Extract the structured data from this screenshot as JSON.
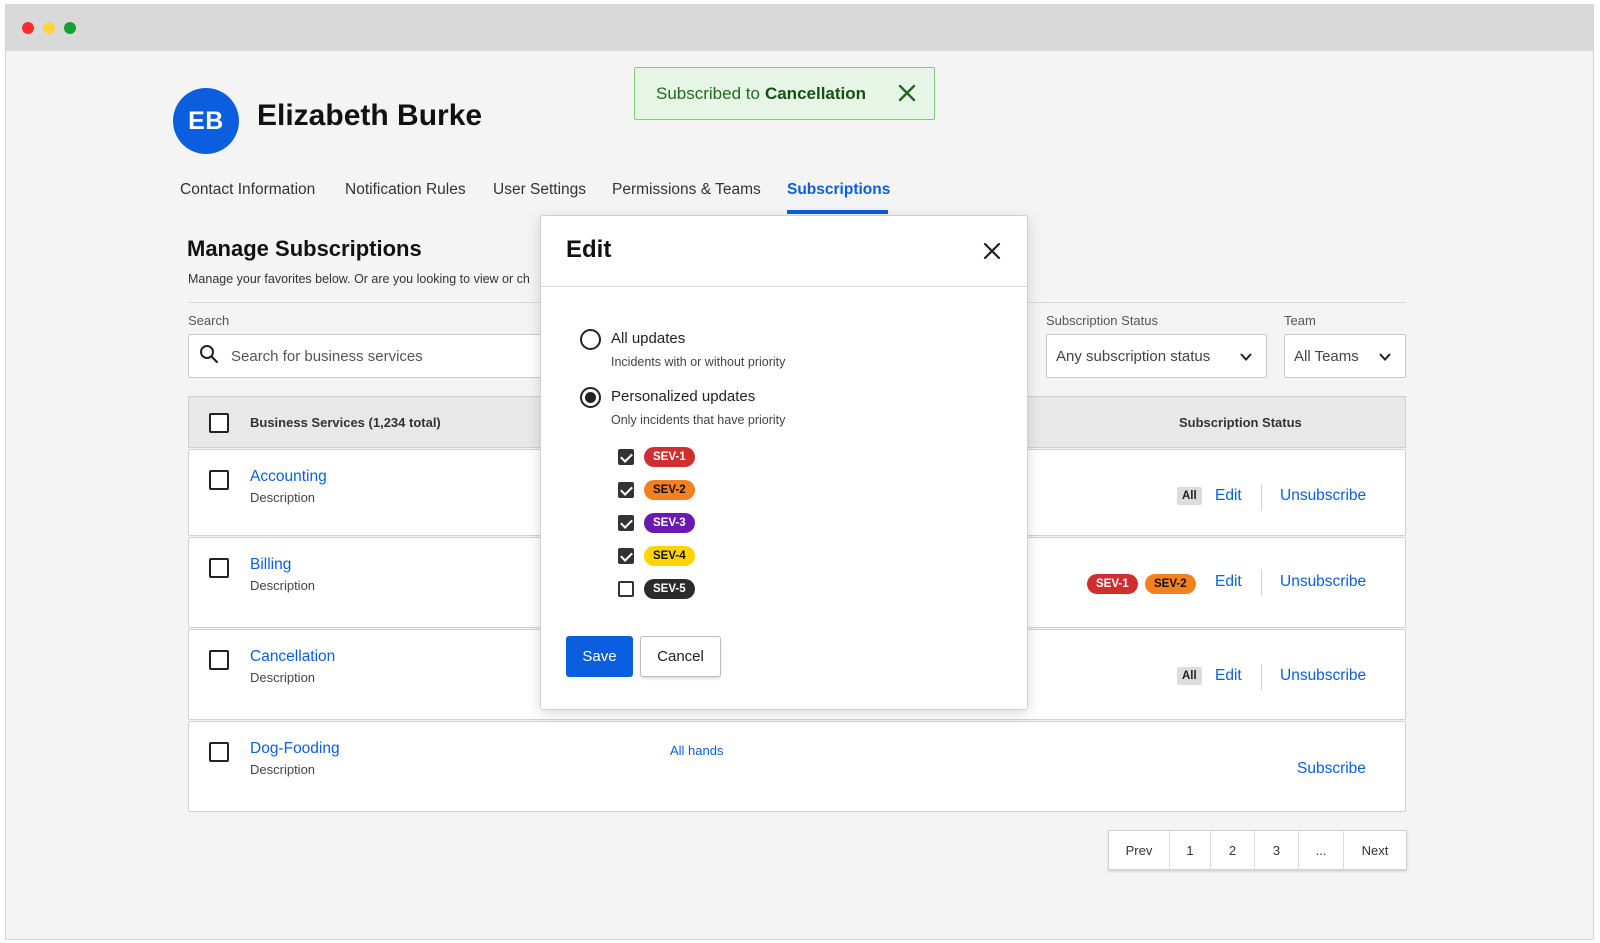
{
  "colors": {
    "accent": "#0b5ede",
    "sev1": "#d12f2f",
    "sev2": "#f4801f",
    "sev3": "#6a1ab0",
    "sev4": "#ffd400",
    "sev5": "#2b2b2b",
    "toast_bg": "#e6f5e6"
  },
  "user": {
    "initials": "EB",
    "name": "Elizabeth Burke"
  },
  "toast": {
    "prefix": "Subscribed to",
    "service": "Cancellation",
    "icon": "close-icon"
  },
  "tabs": [
    {
      "label": "Contact Information",
      "active": false
    },
    {
      "label": "Notification Rules",
      "active": false
    },
    {
      "label": "User Settings",
      "active": false
    },
    {
      "label": "Permissions & Teams",
      "active": false
    },
    {
      "label": "Subscriptions",
      "active": true
    }
  ],
  "section": {
    "title": "Manage Subscriptions",
    "description": "Manage your favorites below. Or are you looking to view or ch"
  },
  "filters": {
    "search_label": "Search",
    "search_placeholder": "Search for business services",
    "status_label": "Subscription Status",
    "status_value": "Any subscription status",
    "team_label": "Team",
    "team_value": "All Teams"
  },
  "table": {
    "header_services": "Business Services (1,234 total)",
    "header_status": "Subscription Status",
    "rows": [
      {
        "name": "Accounting",
        "desc": "Description",
        "badge": "All",
        "actions": [
          "Edit",
          "Unsubscribe"
        ]
      },
      {
        "name": "Billing",
        "desc": "Description",
        "sevs": [
          "SEV-1",
          "SEV-2"
        ],
        "actions": [
          "Edit",
          "Unsubscribe"
        ]
      },
      {
        "name": "Cancellation",
        "desc": "Description",
        "badge": "All",
        "actions": [
          "Edit",
          "Unsubscribe"
        ]
      },
      {
        "name": "Dog-Fooding",
        "desc": "Description",
        "team": "All hands",
        "actions": [
          "Subscribe"
        ]
      }
    ]
  },
  "pagination": [
    "Prev",
    "1",
    "2",
    "3",
    "...",
    "Next"
  ],
  "modal": {
    "title": "Edit",
    "options": [
      {
        "label": "All updates",
        "sub": "Incidents with or without priority",
        "selected": false
      },
      {
        "label": "Personalized updates",
        "sub": "Only incidents that have priority",
        "selected": true
      }
    ],
    "severities": [
      {
        "label": "SEV-1",
        "checked": true
      },
      {
        "label": "SEV-2",
        "checked": true
      },
      {
        "label": "SEV-3",
        "checked": true
      },
      {
        "label": "SEV-4",
        "checked": true
      },
      {
        "label": "SEV-5",
        "checked": false
      }
    ],
    "save_label": "Save",
    "cancel_label": "Cancel"
  }
}
